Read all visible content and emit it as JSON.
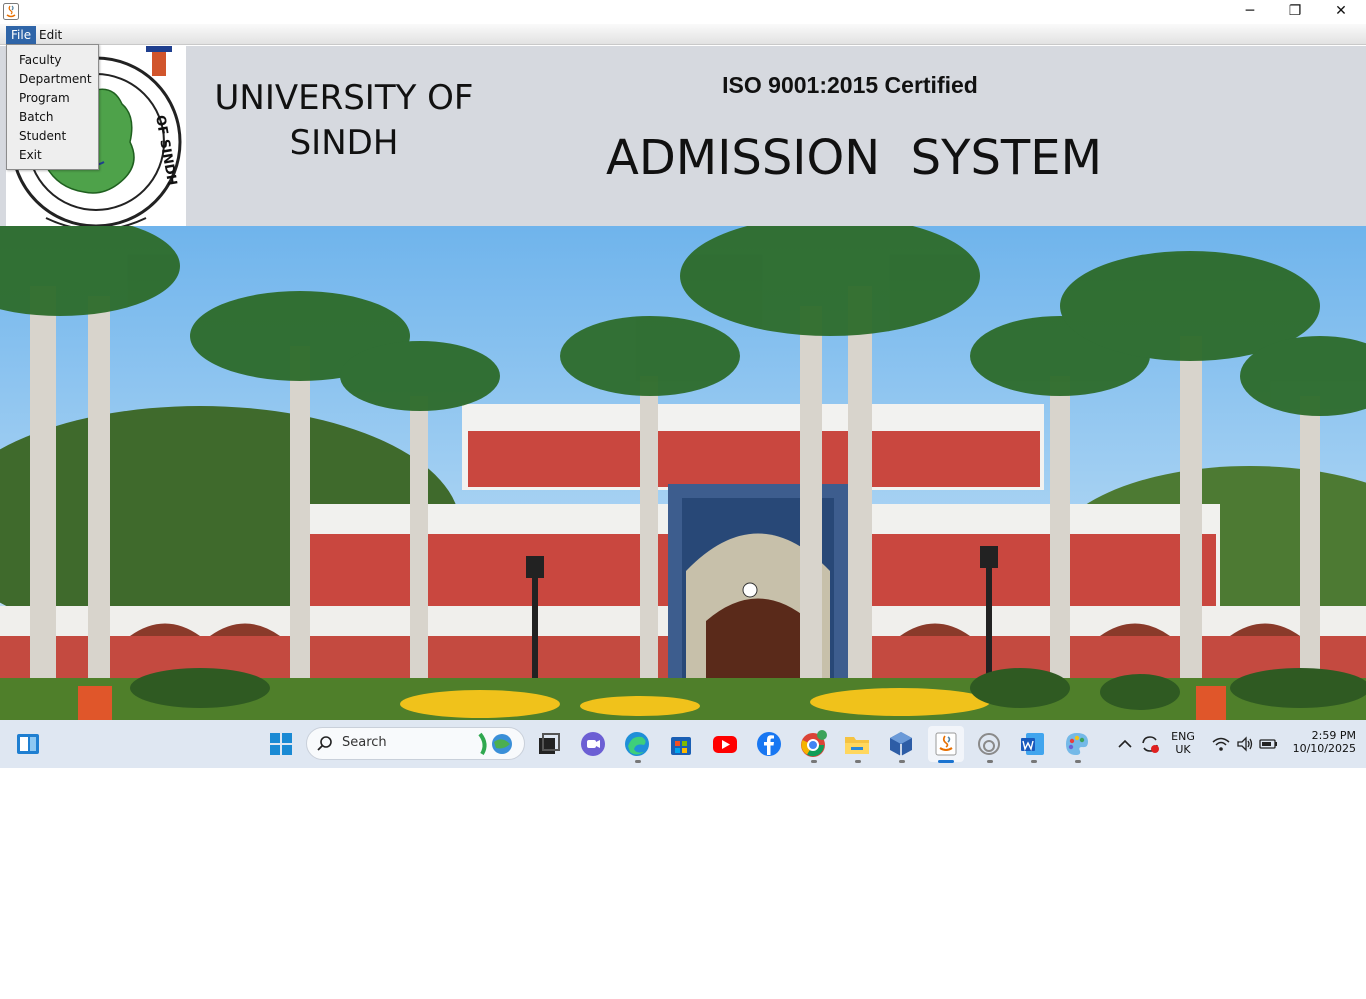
{
  "window": {
    "min_label": "─",
    "max_label": "❐",
    "close_label": "✕"
  },
  "menubar": {
    "file_label": "File",
    "edit_label": "Edit"
  },
  "file_menu": {
    "items": [
      "Faculty",
      "Department",
      "Program",
      "Batch",
      "Student",
      "Exit"
    ]
  },
  "header": {
    "university_line1": "UNIVERSITY OF",
    "university_line2": "SINDH",
    "iso": "ISO 9001:2015 Certified",
    "system_title": "ADMISSION  SYSTEM"
  },
  "logo": {
    "seal_text_right": "OF SINDH"
  },
  "taskbar": {
    "search_placeholder": "Search",
    "language_line1": "ENG",
    "language_line2": "UK",
    "time": "2:59 PM",
    "date": "10/10/2025"
  },
  "colors": {
    "header_bg": "#d6d9df",
    "menu_highlight": "#2f65a8",
    "taskbar_bg": "#dfe7f2",
    "building_brick": "#c9473f"
  }
}
